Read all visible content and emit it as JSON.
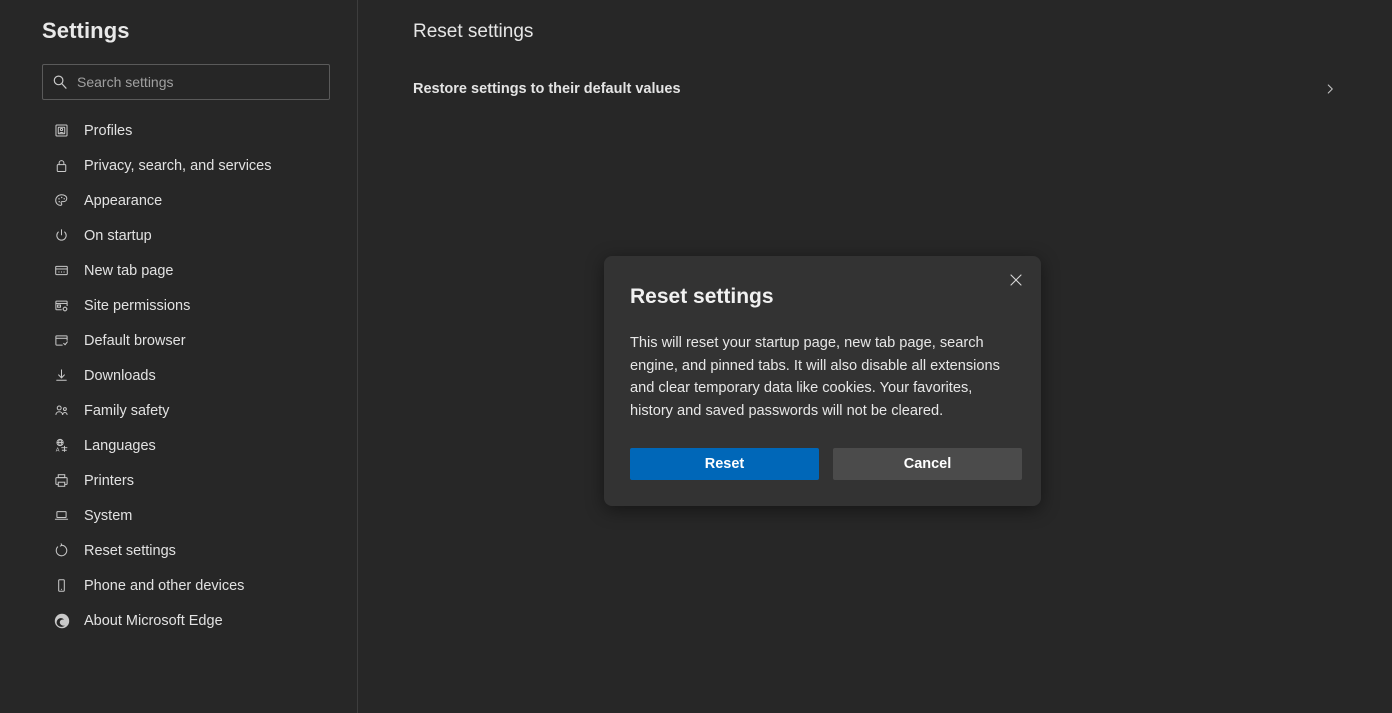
{
  "theme": {
    "page_background": "#272727",
    "sidebar_divider": "#3d3d3d",
    "dialog_background": "#333333",
    "accent_blue": "#0067b8",
    "secondary_button": "#4b4b4b",
    "text_primary": "#e8e8e8",
    "text_muted": "#a0a0a0"
  },
  "sidebar": {
    "title": "Settings",
    "search": {
      "placeholder": "Search settings",
      "value": "",
      "icon": "search-icon"
    },
    "items": [
      {
        "label": "Profiles",
        "icon": "profile-card-icon"
      },
      {
        "label": "Privacy, search, and services",
        "icon": "lock-icon"
      },
      {
        "label": "Appearance",
        "icon": "palette-icon"
      },
      {
        "label": "On startup",
        "icon": "power-icon"
      },
      {
        "label": "New tab page",
        "icon": "new-tab-page-icon"
      },
      {
        "label": "Site permissions",
        "icon": "site-permissions-icon"
      },
      {
        "label": "Default browser",
        "icon": "default-browser-icon"
      },
      {
        "label": "Downloads",
        "icon": "download-arrow-icon"
      },
      {
        "label": "Family safety",
        "icon": "family-people-icon"
      },
      {
        "label": "Languages",
        "icon": "languages-globe-icon"
      },
      {
        "label": "Printers",
        "icon": "printer-icon"
      },
      {
        "label": "System",
        "icon": "laptop-icon"
      },
      {
        "label": "Reset settings",
        "icon": "reset-circular-arrow-icon"
      },
      {
        "label": "Phone and other devices",
        "icon": "phone-icon"
      },
      {
        "label": "About Microsoft Edge",
        "icon": "edge-logo-icon"
      }
    ]
  },
  "main": {
    "title": "Reset settings",
    "rows": [
      {
        "label": "Restore settings to their default values",
        "chevron": "chevron-right-icon"
      }
    ]
  },
  "dialog": {
    "title": "Reset settings",
    "close_icon": "close-icon",
    "body": "This will reset your startup page, new tab page, search engine, and pinned tabs. It will also disable all extensions and clear temporary data like cookies. Your favorites, history and saved passwords will not be cleared.",
    "primary_button": "Reset",
    "secondary_button": "Cancel"
  }
}
